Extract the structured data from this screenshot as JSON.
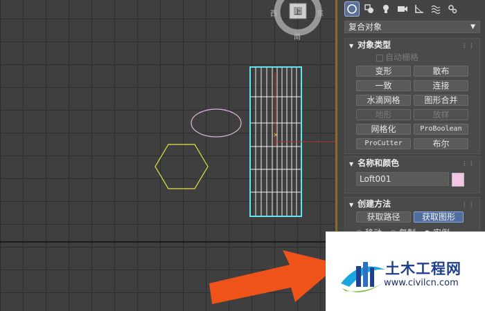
{
  "viewcube": {
    "left": "西",
    "right": "东",
    "bottom": "南",
    "top_face": "上"
  },
  "panel": {
    "tabs": [
      {
        "icon": "sphere-geometry-icon",
        "active": true
      },
      {
        "icon": "shapes-icon"
      },
      {
        "icon": "light-bulb-icon"
      },
      {
        "icon": "camera-icon"
      },
      {
        "icon": "helpers-ruler-icon"
      },
      {
        "icon": "space-warps-icon"
      },
      {
        "icon": "systems-gear-icon"
      }
    ],
    "category": "复合对象",
    "object_type": {
      "title": "对象类型",
      "autogrid": "自动栅格",
      "buttons": [
        "变形",
        "散布",
        "一致",
        "连接",
        "水滴网格",
        "图形合并",
        "地形",
        "放样",
        "网格化",
        "ProBoolean",
        "ProCutter",
        "布尔"
      ]
    },
    "name_color": {
      "title": "名称和颜色",
      "name_value": "Loft001",
      "color": "#f3c6e6"
    },
    "creation": {
      "title": "创建方法",
      "get_path": "获取路径",
      "get_shape": "获取图形",
      "options": [
        "移动",
        "复制",
        "实例"
      ]
    }
  },
  "watermark": {
    "title": "土木工程网",
    "url": "www.civilcn.com"
  },
  "colors": {
    "accent_border": "#8c6a2a",
    "selection": "#5fe6f0",
    "arrow": "#f0531a"
  }
}
